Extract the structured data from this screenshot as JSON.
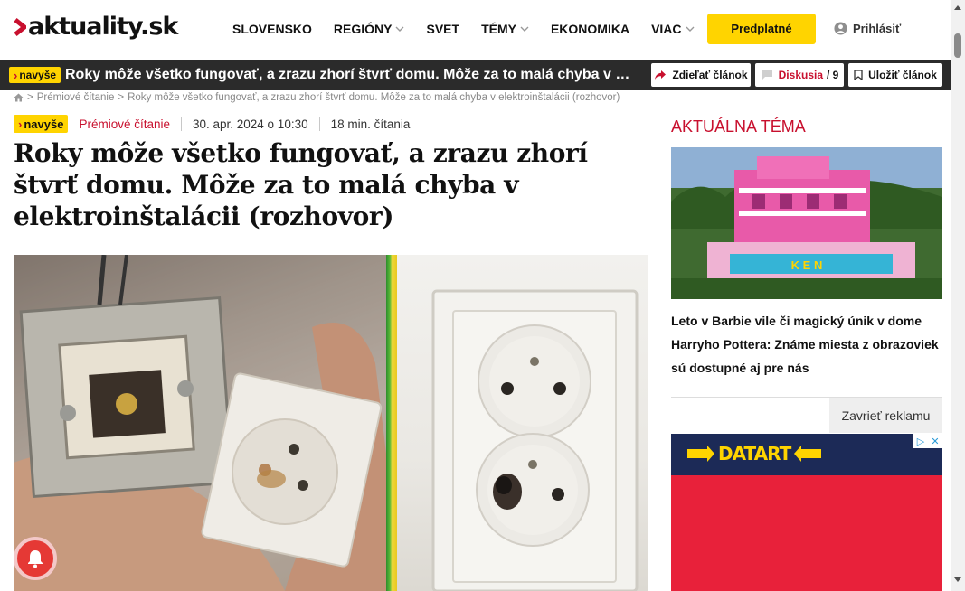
{
  "site": {
    "logo": "aktuality.sk"
  },
  "nav": {
    "items": [
      {
        "label": "SLOVENSKO",
        "dropdown": false
      },
      {
        "label": "REGIÓNY",
        "dropdown": true
      },
      {
        "label": "SVET",
        "dropdown": false
      },
      {
        "label": "TÉMY",
        "dropdown": true
      },
      {
        "label": "EKONOMIKA",
        "dropdown": false
      },
      {
        "label": "VIAC",
        "dropdown": true
      }
    ],
    "subscribe_label": "Predplatné",
    "login_label": "Prihlásiť"
  },
  "sticky": {
    "badge": "navyše",
    "title": "Roky môže všetko fungovať, a zrazu zhorí štvrť domu. Môže za to malá chyba v elektroinšt...",
    "share_label": "Zdieľať článok",
    "discussion_label": "Diskusia",
    "discussion_count": "/ 9",
    "save_label": "Uložiť článok"
  },
  "breadcrumb": {
    "items": [
      "Prémiové čítanie",
      "Roky môže všetko fungovať, a zrazu zhorí štvrť domu. Môže za to malá chyba v elektroinštalácii (rozhovor)"
    ]
  },
  "article": {
    "badge": "navyše",
    "category": "Prémiové čítanie",
    "date": "30. apr. 2024 o 10:30",
    "read_time": "18 min. čítania",
    "headline": "Roky môže všetko fungovať, a zrazu zhorí štvrť domu. Môže za to malá chyba v elektroinštalácii (rozhovor)"
  },
  "sidebar": {
    "topic_heading": "AKTUÁLNA TÉMA",
    "topic_text": "Leto v Barbie vile či magický únik v dome Harryho Pottera: Známe miesta z obrazoviek sú dostupné aj pre nás",
    "close_ad_label": "Zavrieť reklamu",
    "ad_brand": "DATART",
    "house_sign": "K E N"
  },
  "colors": {
    "brand_red": "#c8102e",
    "accent_yellow": "#ffd400",
    "sticky_bg": "#2b2b2b"
  }
}
